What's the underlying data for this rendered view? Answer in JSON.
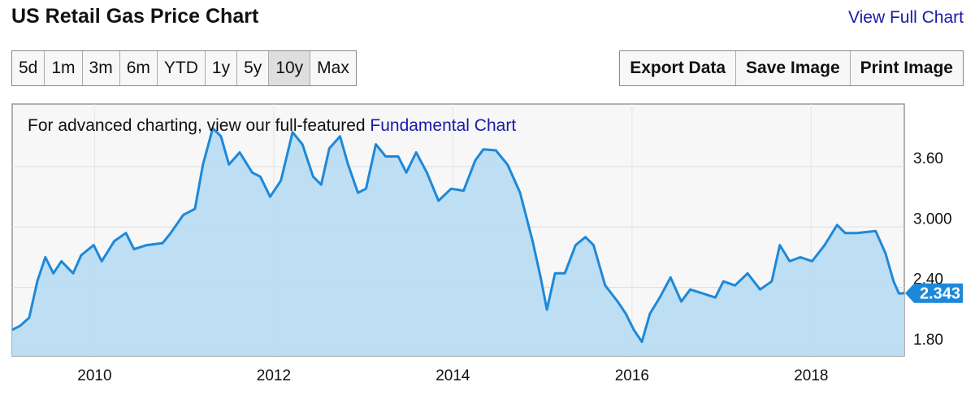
{
  "header": {
    "title": "US Retail Gas Price Chart",
    "view_full": "View Full Chart"
  },
  "ranges": [
    {
      "label": "5d"
    },
    {
      "label": "1m"
    },
    {
      "label": "3m"
    },
    {
      "label": "6m"
    },
    {
      "label": "YTD"
    },
    {
      "label": "1y"
    },
    {
      "label": "5y"
    },
    {
      "label": "10y",
      "active": true
    },
    {
      "label": "Max"
    }
  ],
  "actions": [
    {
      "label": "Export Data"
    },
    {
      "label": "Save Image"
    },
    {
      "label": "Print Image"
    }
  ],
  "note": {
    "text": "For advanced charting, view our full-featured ",
    "link": "Fundamental Chart"
  },
  "chart_data": {
    "type": "area",
    "xlim": [
      2009.08,
      2019.04
    ],
    "ylim": [
      1.72,
      4.22
    ],
    "x_ticks": [
      {
        "v": 2010,
        "label": "2010"
      },
      {
        "v": 2012,
        "label": "2012"
      },
      {
        "v": 2014,
        "label": "2014"
      },
      {
        "v": 2016,
        "label": "2016"
      },
      {
        "v": 2018,
        "label": "2018"
      }
    ],
    "y_ticks": [
      {
        "v": 1.8,
        "label": "1.80"
      },
      {
        "v": 2.4,
        "label": "2.40"
      },
      {
        "v": 3.0,
        "label": "3.000"
      },
      {
        "v": 3.6,
        "label": "3.60"
      }
    ],
    "last_value_label": "2.343",
    "grid": true,
    "colors": {
      "line": "#1e88d8",
      "fill": "#b9dcf2",
      "background": "#f7f7f7",
      "tag": "#1e88d8"
    },
    "x": [
      2009.08,
      2009.17,
      2009.27,
      2009.36,
      2009.45,
      2009.54,
      2009.63,
      2009.76,
      2009.85,
      2009.99,
      2010.08,
      2010.22,
      2010.35,
      2010.44,
      2010.58,
      2010.76,
      2010.85,
      2010.99,
      2011.12,
      2011.21,
      2011.32,
      2011.41,
      2011.5,
      2011.62,
      2011.76,
      2011.85,
      2011.96,
      2012.08,
      2012.21,
      2012.32,
      2012.44,
      2012.53,
      2012.62,
      2012.74,
      2012.83,
      2012.94,
      2013.03,
      2013.14,
      2013.25,
      2013.39,
      2013.48,
      2013.59,
      2013.71,
      2013.84,
      2013.98,
      2014.12,
      2014.25,
      2014.34,
      2014.48,
      2014.61,
      2014.75,
      2014.89,
      2014.98,
      2015.05,
      2015.14,
      2015.25,
      2015.37,
      2015.48,
      2015.57,
      2015.7,
      2015.84,
      2015.93,
      2016.02,
      2016.11,
      2016.2,
      2016.31,
      2016.43,
      2016.55,
      2016.65,
      2016.79,
      2016.93,
      2017.02,
      2017.15,
      2017.29,
      2017.43,
      2017.56,
      2017.65,
      2017.76,
      2017.88,
      2018.01,
      2018.15,
      2018.29,
      2018.38,
      2018.51,
      2018.72,
      2018.83,
      2018.92,
      2018.98,
      2019.04
    ],
    "y": [
      1.98,
      2.02,
      2.1,
      2.46,
      2.7,
      2.54,
      2.66,
      2.54,
      2.72,
      2.82,
      2.66,
      2.86,
      2.94,
      2.78,
      2.82,
      2.84,
      2.94,
      3.12,
      3.18,
      3.62,
      3.98,
      3.9,
      3.62,
      3.74,
      3.54,
      3.5,
      3.3,
      3.46,
      3.94,
      3.82,
      3.5,
      3.42,
      3.78,
      3.9,
      3.62,
      3.34,
      3.38,
      3.82,
      3.7,
      3.7,
      3.54,
      3.74,
      3.54,
      3.26,
      3.38,
      3.36,
      3.66,
      3.77,
      3.76,
      3.62,
      3.34,
      2.86,
      2.5,
      2.18,
      2.54,
      2.54,
      2.82,
      2.9,
      2.82,
      2.42,
      2.26,
      2.14,
      1.98,
      1.86,
      2.14,
      2.3,
      2.5,
      2.26,
      2.38,
      2.34,
      2.3,
      2.46,
      2.42,
      2.54,
      2.38,
      2.46,
      2.82,
      2.66,
      2.7,
      2.66,
      2.82,
      3.02,
      2.94,
      2.94,
      2.96,
      2.74,
      2.46,
      2.34,
      2.343
    ]
  }
}
